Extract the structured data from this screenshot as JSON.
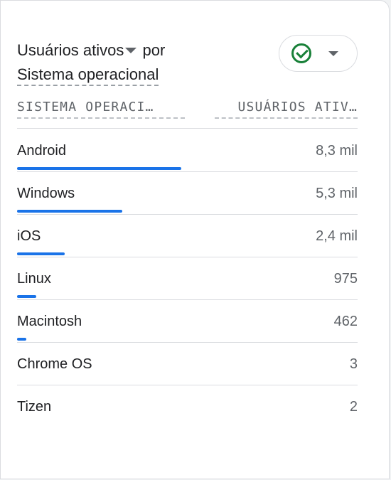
{
  "card": {
    "title_metric": "Usuários ativos",
    "title_connector": "por",
    "title_dimension": "Sistema operacional",
    "compare_chip": {
      "status_icon": "check-circle-icon",
      "dropdown_icon": "chevron-down-icon"
    }
  },
  "table": {
    "headers": {
      "dimension": "SISTEMA OPERACI…",
      "metric": "USUÁRIOS ATIV…"
    },
    "rows": [
      {
        "label": "Android",
        "value": "8,3 mil",
        "bar_fraction": 1.0
      },
      {
        "label": "Windows",
        "value": "5,3 mil",
        "bar_fraction": 0.64
      },
      {
        "label": "iOS",
        "value": "2,4 mil",
        "bar_fraction": 0.29
      },
      {
        "label": "Linux",
        "value": "975",
        "bar_fraction": 0.117
      },
      {
        "label": "Macintosh",
        "value": "462",
        "bar_fraction": 0.056
      },
      {
        "label": "Chrome OS",
        "value": "3",
        "bar_fraction": 0
      },
      {
        "label": "Tizen",
        "value": "2",
        "bar_fraction": 0
      }
    ]
  },
  "colors": {
    "bar": "#1a73e8",
    "check": "#188038"
  }
}
